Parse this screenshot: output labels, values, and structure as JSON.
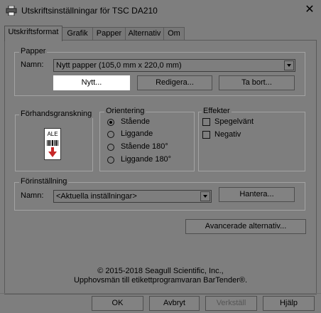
{
  "window": {
    "title": "Utskriftsinställningar för TSC DA210",
    "close_glyph": "✕"
  },
  "tabs": [
    {
      "label": "Utskriftsformat",
      "active": true
    },
    {
      "label": "Grafik"
    },
    {
      "label": "Papper"
    },
    {
      "label": "Alternativ"
    },
    {
      "label": "Om"
    }
  ],
  "paper": {
    "group_label": "Papper",
    "name_label": "Namn:",
    "name_value": "Nytt papper (105,0 mm x 220,0 mm)",
    "new_button": "Nytt...",
    "edit_button": "Redigera...",
    "delete_button": "Ta bort..."
  },
  "preview": {
    "group_label": "Förhandsgranskning",
    "label_text": "ALE"
  },
  "orientation": {
    "group_label": "Orientering",
    "options": [
      {
        "label": "Stående",
        "checked": true
      },
      {
        "label": "Liggande",
        "checked": false
      },
      {
        "label": "Stående 180°",
        "checked": false
      },
      {
        "label": "Liggande 180°",
        "checked": false
      }
    ]
  },
  "effects": {
    "group_label": "Effekter",
    "options": [
      {
        "label": "Spegelvänt",
        "checked": false
      },
      {
        "label": "Negativ",
        "checked": false
      }
    ]
  },
  "preset": {
    "group_label": "Förinställning",
    "name_label": "Namn:",
    "name_value": "<Aktuella inställningar>",
    "manage_button": "Hantera..."
  },
  "advanced_button": "Avancerade alternativ...",
  "copyright": {
    "line1": "© 2015-2018 Seagull Scientific, Inc.,",
    "line2": "Upphovsmän till etikettprogramvaran BarTender®."
  },
  "footer": {
    "ok": "OK",
    "cancel": "Avbryt",
    "apply": "Verkställ",
    "help": "Hjälp"
  },
  "colors": {
    "background": "#7e7e7e",
    "highlight_button": "#ffffff",
    "preview_arrow": "#c62828"
  }
}
